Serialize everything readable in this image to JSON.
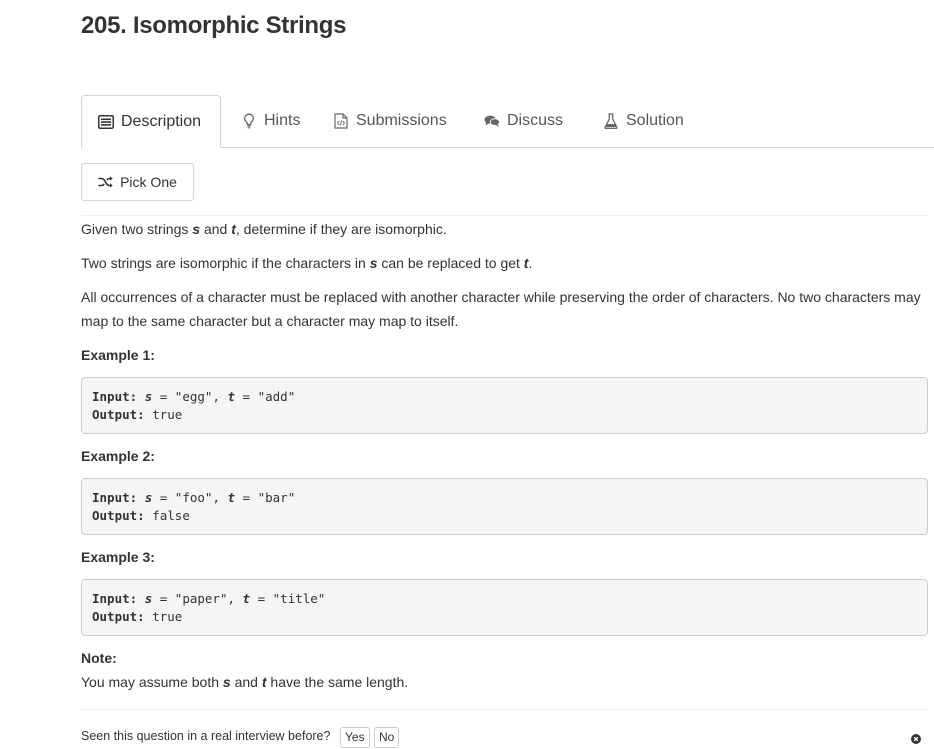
{
  "problem": {
    "title": "205. Isomorphic Strings"
  },
  "tabs": [
    {
      "label": "Description",
      "icon": "description-icon",
      "active": true
    },
    {
      "label": "Hints",
      "icon": "lightbulb-icon",
      "active": false
    },
    {
      "label": "Submissions",
      "icon": "code-file-icon",
      "active": false
    },
    {
      "label": "Discuss",
      "icon": "comments-icon",
      "active": false
    },
    {
      "label": "Solution",
      "icon": "flask-icon",
      "active": false
    }
  ],
  "pick_one": {
    "label": "Pick One",
    "icon": "shuffle-icon"
  },
  "description": {
    "p1": {
      "before": "Given two strings ",
      "var1": "s",
      "mid": " and ",
      "var2": "t",
      "after": ", determine if they are isomorphic."
    },
    "p2": {
      "before": "Two strings are isomorphic if the characters in ",
      "var1": "s",
      "mid": " can be replaced to get ",
      "var2": "t",
      "after": "."
    },
    "p3": "All occurrences of a character must be replaced with another character while preserving the order of characters. No two characters may map to the same character but a character may map to itself."
  },
  "examples": [
    {
      "heading": "Example 1:",
      "input_label": "Input:",
      "s_name": "s",
      "s_value": "\"egg\"",
      "t_name": "t",
      "t_value": "\"add\"",
      "output_label": "Output:",
      "output": "true"
    },
    {
      "heading": "Example 2:",
      "input_label": "Input:",
      "s_name": "s",
      "s_value": "\"foo\"",
      "t_name": "t",
      "t_value": "\"bar\"",
      "output_label": "Output:",
      "output": "false"
    },
    {
      "heading": "Example 3:",
      "input_label": "Input:",
      "s_name": "s",
      "s_value": "\"paper\"",
      "t_name": "t",
      "t_value": "\"title\"",
      "output_label": "Output:",
      "output": "true"
    }
  ],
  "note": {
    "heading": "Note:",
    "before": "You may assume both ",
    "var1": "s",
    "mid": " and ",
    "var2": "t",
    "after": " have the same length."
  },
  "footer": {
    "question": "Seen this question in a real interview before?",
    "yes_label": "Yes",
    "no_label": "No",
    "close_icon": "close-circle-icon"
  }
}
